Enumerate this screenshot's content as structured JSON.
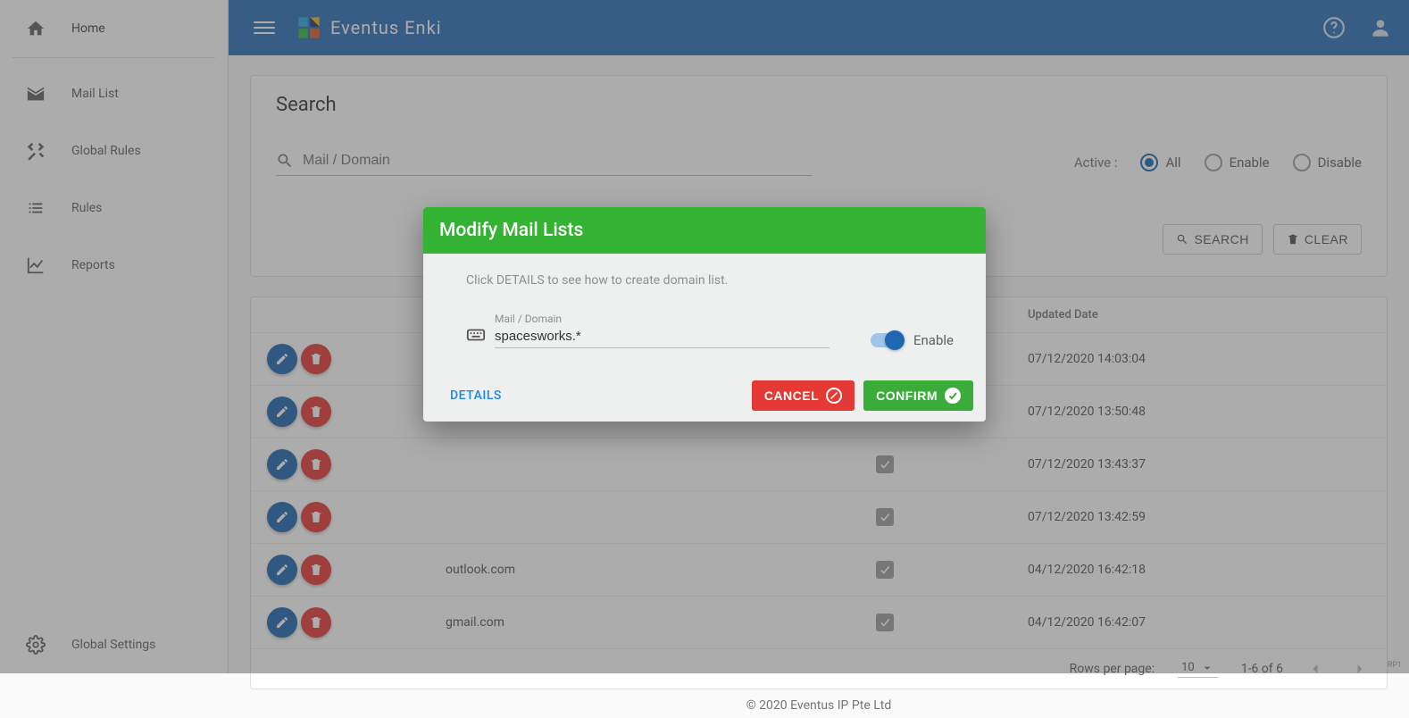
{
  "app": {
    "title": "Eventus Enki"
  },
  "sidebar": {
    "items": [
      {
        "label": "Home"
      },
      {
        "label": "Mail List"
      },
      {
        "label": "Global Rules"
      },
      {
        "label": "Rules"
      },
      {
        "label": "Reports"
      }
    ],
    "bottom": {
      "label": "Global Settings"
    }
  },
  "search": {
    "title": "Search",
    "placeholder": "Mail / Domain",
    "active_label": "Active :",
    "options": {
      "all": "All",
      "enable": "Enable",
      "disable": "Disable"
    },
    "selected": "all",
    "search_btn": "SEARCH",
    "clear_btn": "CLEAR"
  },
  "table": {
    "headers": {
      "updated": "Updated Date"
    },
    "rows": [
      {
        "domain": "",
        "updated": "07/12/2020 14:03:04"
      },
      {
        "domain": "",
        "updated": "07/12/2020 13:50:48"
      },
      {
        "domain": "",
        "updated": "07/12/2020 13:43:37"
      },
      {
        "domain": "",
        "updated": "07/12/2020 13:42:59"
      },
      {
        "domain": "outlook.com",
        "updated": "04/12/2020 16:42:18"
      },
      {
        "domain": "gmail.com",
        "updated": "04/12/2020 16:42:07"
      }
    ],
    "footer": {
      "rows_label": "Rows per page:",
      "page_size": "10",
      "range": "1-6 of 6"
    }
  },
  "dialog": {
    "title": "Modify Mail Lists",
    "hint": "Click DETAILS to see how to create domain list.",
    "field_label": "Mail / Domain",
    "field_value": "spacesworks.*",
    "toggle_label": "Enable",
    "details": "DETAILS",
    "cancel": "CANCEL",
    "confirm": "CONFIRM"
  },
  "footer": {
    "copyright": "© 2020 Eventus IP Pte Ltd",
    "tag": "RP1"
  }
}
